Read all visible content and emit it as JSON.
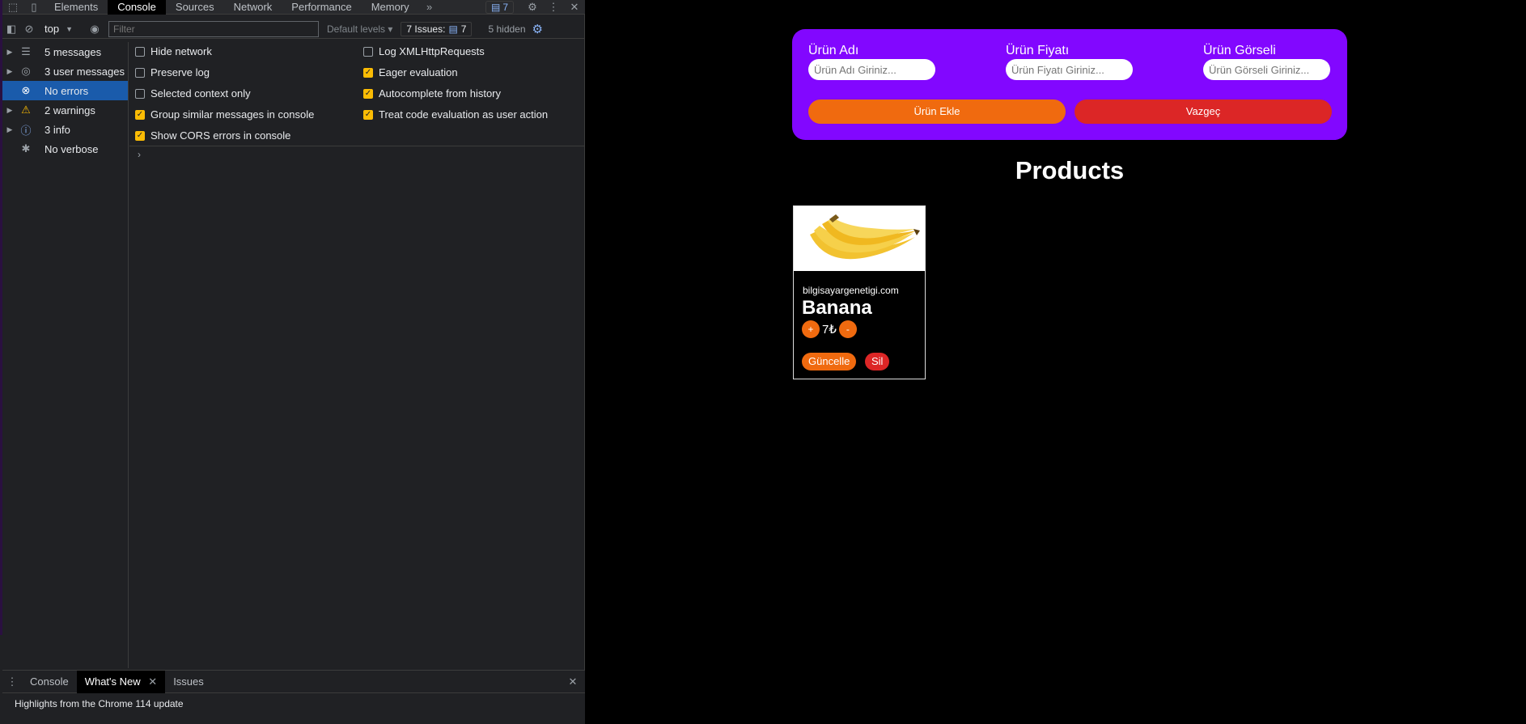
{
  "devtools": {
    "tabs": [
      "Elements",
      "Console",
      "Sources",
      "Network",
      "Performance",
      "Memory"
    ],
    "active_tab": "Console",
    "message_count": "7",
    "toolbar": {
      "context": "top",
      "filter_placeholder": "Filter",
      "levels": "Default levels",
      "issues_label": "7 Issues:",
      "issues_count": "7",
      "hidden": "5 hidden"
    },
    "sidebar": [
      {
        "label": "5 messages",
        "icon": "list-icon"
      },
      {
        "label": "3 user messages",
        "icon": "user-icon"
      },
      {
        "label": "No errors",
        "icon": "error-icon"
      },
      {
        "label": "2 warnings",
        "icon": "warning-icon"
      },
      {
        "label": "3 info",
        "icon": "info-icon"
      },
      {
        "label": "No verbose",
        "icon": "bug-icon"
      }
    ],
    "settings_left": [
      {
        "label": "Hide network",
        "checked": false
      },
      {
        "label": "Preserve log",
        "checked": false
      },
      {
        "label": "Selected context only",
        "checked": false
      },
      {
        "label": "Group similar messages in console",
        "checked": true
      },
      {
        "label": "Show CORS errors in console",
        "checked": true
      }
    ],
    "settings_right": [
      {
        "label": "Log XMLHttpRequests",
        "checked": false
      },
      {
        "label": "Eager evaluation",
        "checked": true
      },
      {
        "label": "Autocomplete from history",
        "checked": true
      },
      {
        "label": "Treat code evaluation as user action",
        "checked": true
      }
    ],
    "drawer": {
      "tabs": [
        "Console",
        "What's New",
        "Issues"
      ],
      "active": "What's New",
      "text": "Highlights from the Chrome 114 update"
    }
  },
  "page": {
    "form": {
      "name_label": "Ürün Adı",
      "name_placeholder": "Ürün Adı Giriniz...",
      "price_label": "Ürün Fiyatı",
      "price_placeholder": "Ürün Fiyatı Giriniz...",
      "image_label": "Ürün Görseli",
      "image_placeholder": "Ürün Görseli Giriniz...",
      "add_button": "Ürün Ekle",
      "cancel_button": "Vazgeç"
    },
    "heading": "Products",
    "product": {
      "site": "bilgisayargenetigi.com",
      "name": "Banana",
      "plus": "+",
      "price": "7₺",
      "minus": "-",
      "update_button": "Güncelle",
      "delete_button": "Sil"
    }
  }
}
